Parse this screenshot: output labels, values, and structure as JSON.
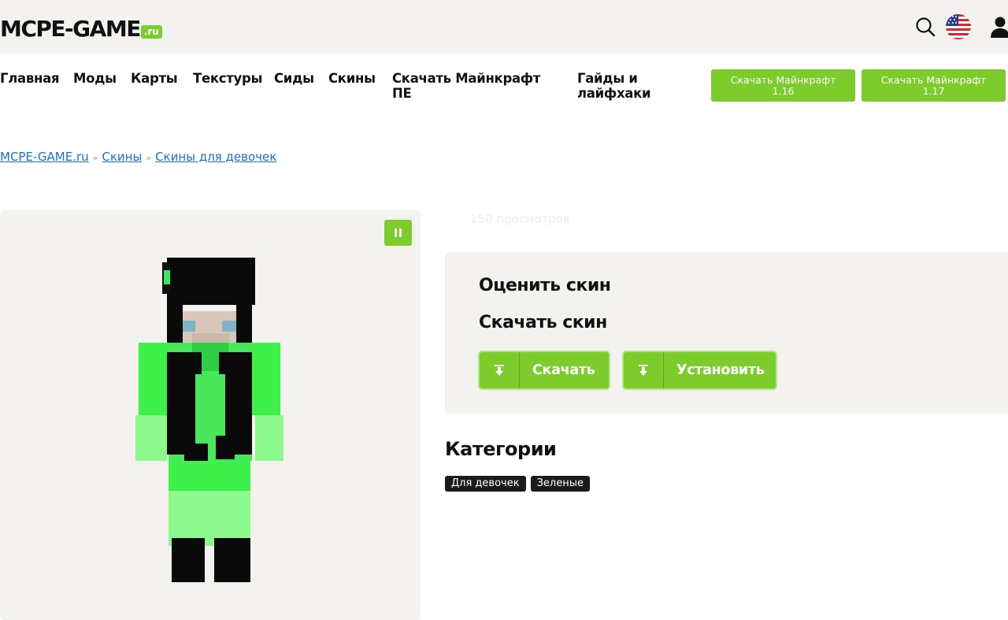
{
  "header": {
    "logo_main": "MCPE-GAME",
    "logo_tld": ".ru",
    "icons": [
      "search-icon",
      "us-flag-icon",
      "user-icon"
    ]
  },
  "nav": {
    "items": [
      {
        "label": "Главная"
      },
      {
        "label": "Моды"
      },
      {
        "label": "Карты"
      },
      {
        "label": "Текстуры"
      },
      {
        "label": "Сиды"
      },
      {
        "label": "Скины"
      },
      {
        "label_line1": "Скачать Майнкрафт",
        "label_line2": "ПЕ"
      },
      {
        "label_line1": "Гайды и",
        "label_line2": "лайфхаки"
      }
    ],
    "buttons": [
      {
        "line1": "Скачать Майнкрафт",
        "line2": "1.16"
      },
      {
        "line1": "Скачать Майнкрафт",
        "line2": "1.17"
      }
    ]
  },
  "breadcrumb": {
    "items": [
      "MCPE-GAME.ru",
      "Скины",
      "Скины для девочек"
    ],
    "separator": "»"
  },
  "skin": {
    "views": "150 просмотров",
    "rate_title": "Оценить скин",
    "download_title": "Скачать скин",
    "download_label": "Скачать",
    "install_label": "Установить"
  },
  "categories": {
    "title": "Категории",
    "tags": [
      "Для девочек",
      "Зеленые"
    ]
  },
  "colors": {
    "accent": "#7ccc2b",
    "panel": "#f4f2ee",
    "link": "#1a6fd0",
    "tag_bg": "#1b1b1b"
  }
}
